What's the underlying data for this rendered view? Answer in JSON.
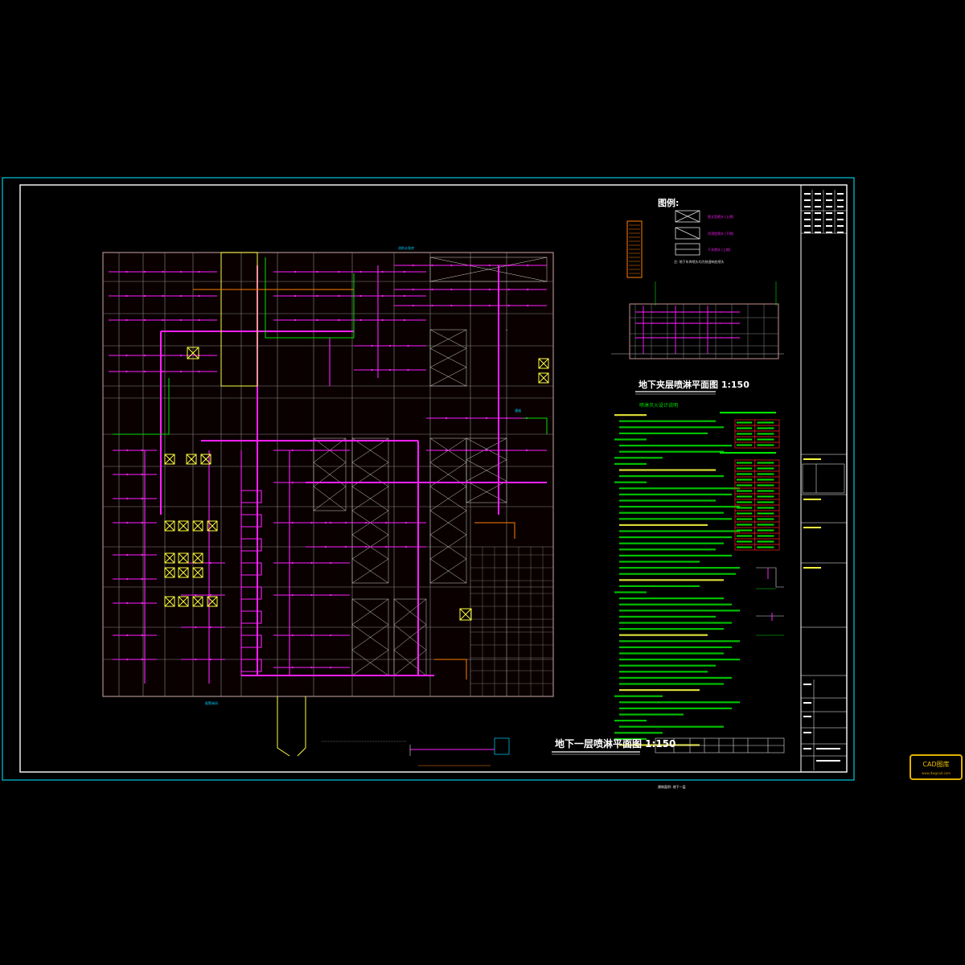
{
  "drawing": {
    "main_plan_title": "地下一层喷淋平面图 1:150",
    "mezzanine_plan_title": "地下夹层喷淋平面图 1:150",
    "legend_title": "图例:",
    "design_notes_title": "喷淋灭火设计说明",
    "bottom_caption": "建筑面积: 地下一层",
    "logo_text": "CAD图库",
    "logo_sub": "www.dwgcad.com"
  },
  "colors": {
    "frame": "#00c8e0",
    "border": "#ffffff",
    "pipe": "#ff20ff",
    "grid": "#b0b0b0",
    "wall": "#c89090",
    "text_green": "#00e000",
    "text_yellow": "#ffff40",
    "table_red": "#ff2020",
    "orange": "#ff8000",
    "logo_gold": "#e0b000"
  }
}
